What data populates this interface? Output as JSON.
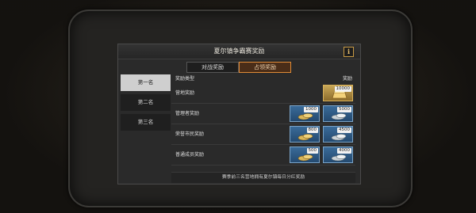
{
  "title": "夏尔镇争霸赛奖励",
  "info_button": "i",
  "tabs": [
    {
      "label": "对战奖励",
      "active": false
    },
    {
      "label": "占领奖励",
      "active": true
    }
  ],
  "ranks": [
    {
      "label": "第一名",
      "active": true
    },
    {
      "label": "第二名",
      "active": false
    },
    {
      "label": "第三名",
      "active": false
    }
  ],
  "table": {
    "col_type": "奖励类型",
    "col_reward": "奖励",
    "rows": [
      {
        "type": "营地奖励",
        "rewards": [
          {
            "qty": "10000",
            "icon": "gold-bar-icon"
          }
        ]
      },
      {
        "type": "管理者奖励",
        "rewards": [
          {
            "qty": "1000",
            "icon": "gold-coins-icon"
          },
          {
            "qty": "5000",
            "icon": "silver-coins-icon"
          }
        ]
      },
      {
        "type": "荣誉市民奖励",
        "rewards": [
          {
            "qty": "800",
            "icon": "gold-coins-icon"
          },
          {
            "qty": "4500",
            "icon": "silver-coins-icon"
          }
        ]
      },
      {
        "type": "普通成员奖励",
        "rewards": [
          {
            "qty": "500",
            "icon": "gold-coins-icon"
          },
          {
            "qty": "4000",
            "icon": "silver-coins-icon"
          }
        ]
      }
    ]
  },
  "note": "赛季前三名营地拥有夏尔镇每日分红奖励",
  "colors": {
    "accent": "#e08b37",
    "reward_tile": "#2f5d8a",
    "gold_tile": "#c7a657"
  }
}
